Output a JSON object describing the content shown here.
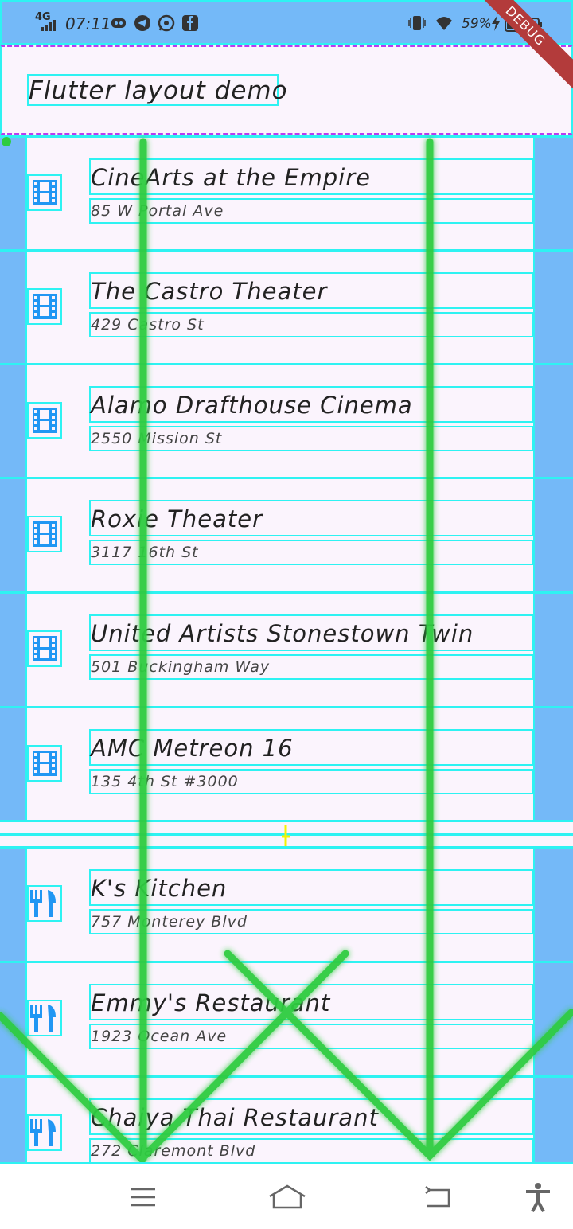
{
  "status_bar": {
    "network": "4G",
    "time": "07:11",
    "battery": "59%",
    "icons": [
      "signal-icon",
      "discord-icon",
      "telegram-icon",
      "whatsapp-icon",
      "facebook-icon",
      "vibrate-icon",
      "wifi-icon",
      "battery-icon"
    ]
  },
  "debug_banner": "DEBUG",
  "app_bar": {
    "title": "Flutter layout demo"
  },
  "list": {
    "theaters": [
      {
        "title": "CineArts at the Empire",
        "subtitle": "85 W Portal Ave",
        "icon": "theater-icon"
      },
      {
        "title": "The Castro Theater",
        "subtitle": "429 Castro St",
        "icon": "theater-icon"
      },
      {
        "title": "Alamo Drafthouse Cinema",
        "subtitle": "2550 Mission St",
        "icon": "theater-icon"
      },
      {
        "title": "Roxie Theater",
        "subtitle": "3117 16th St",
        "icon": "theater-icon"
      },
      {
        "title": "United Artists Stonestown Twin",
        "subtitle": "501 Buckingham Way",
        "icon": "theater-icon"
      },
      {
        "title": "AMC Metreon 16",
        "subtitle": "135 4th St #3000",
        "icon": "theater-icon"
      }
    ],
    "restaurants": [
      {
        "title": "K's Kitchen",
        "subtitle": "757 Monterey Blvd",
        "icon": "restaurant-icon"
      },
      {
        "title": "Emmy's Restaurant",
        "subtitle": "1923 Ocean Ave",
        "icon": "restaurant-icon"
      },
      {
        "title": "Chaiya Thai Restaurant",
        "subtitle": "272 Claremont Blvd",
        "icon": "restaurant-icon"
      }
    ]
  },
  "nav_bar": {
    "buttons": [
      "menu-icon",
      "home-icon",
      "back-icon",
      "accessibility-icon"
    ]
  },
  "colors": {
    "accent": "#2196f3",
    "debug_outline": "#2ef2f2",
    "background": "#74b9f8",
    "gesture": "#2ecc40"
  }
}
